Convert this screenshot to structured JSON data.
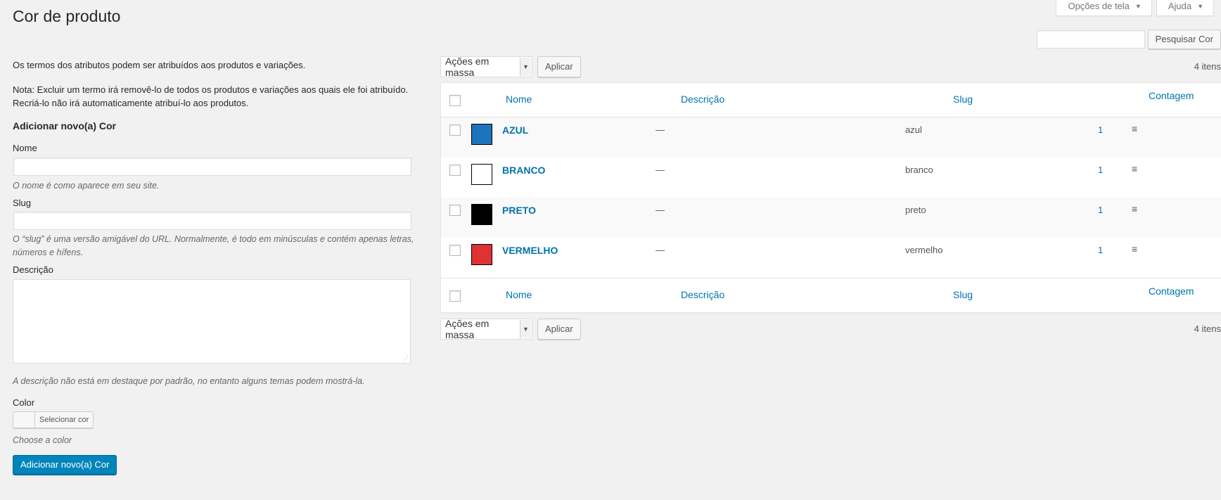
{
  "screen_meta": {
    "screen_options": "Opções de tela",
    "help": "Ajuda"
  },
  "page": {
    "title": "Cor de produto"
  },
  "search": {
    "button": "Pesquisar Cor",
    "value": ""
  },
  "intro": {
    "line1": "Os termos dos atributos podem ser atribuídos aos produtos e variações.",
    "line2": "Nota: Excluir um termo irá removê-lo de todos os produtos e variações aos quais ele foi atribuído. Recriá-lo não irá automaticamente atribuí-lo aos produtos."
  },
  "form": {
    "heading": "Adicionar novo(a) Cor",
    "name_label": "Nome",
    "name_help": "O nome é como aparece em seu site.",
    "slug_label": "Slug",
    "slug_help": "O “slug” é uma versão amigável do URL. Normalmente, é todo em minúsculas e contém apenas letras, números e hífens.",
    "desc_label": "Descrição",
    "desc_help": "A descrição não está em destaque por padrão, no entanto alguns temas podem mostrá-la.",
    "color_label": "Color",
    "color_button": "Selecionar cor",
    "color_help": "Choose a color",
    "submit": "Adicionar novo(a) Cor"
  },
  "tablenav": {
    "bulk_actions": "Ações em massa",
    "apply": "Aplicar",
    "items_count": "4 itens"
  },
  "table": {
    "columns": {
      "name": "Nome",
      "description": "Descrição",
      "slug": "Slug",
      "count": "Contagem"
    },
    "rows": [
      {
        "name": "AZUL",
        "description": "—",
        "slug": "azul",
        "count": "1",
        "color": "#1e73be"
      },
      {
        "name": "BRANCO",
        "description": "—",
        "slug": "branco",
        "count": "1",
        "color": "#ffffff"
      },
      {
        "name": "PRETO",
        "description": "—",
        "slug": "preto",
        "count": "1",
        "color": "#000000"
      },
      {
        "name": "VERMELHO",
        "description": "—",
        "slug": "vermelho",
        "count": "1",
        "color": "#dd3333"
      }
    ]
  },
  "colors": {
    "link": "#0073aa",
    "primary_button": "#0085ba",
    "background": "#f1f1f1"
  }
}
